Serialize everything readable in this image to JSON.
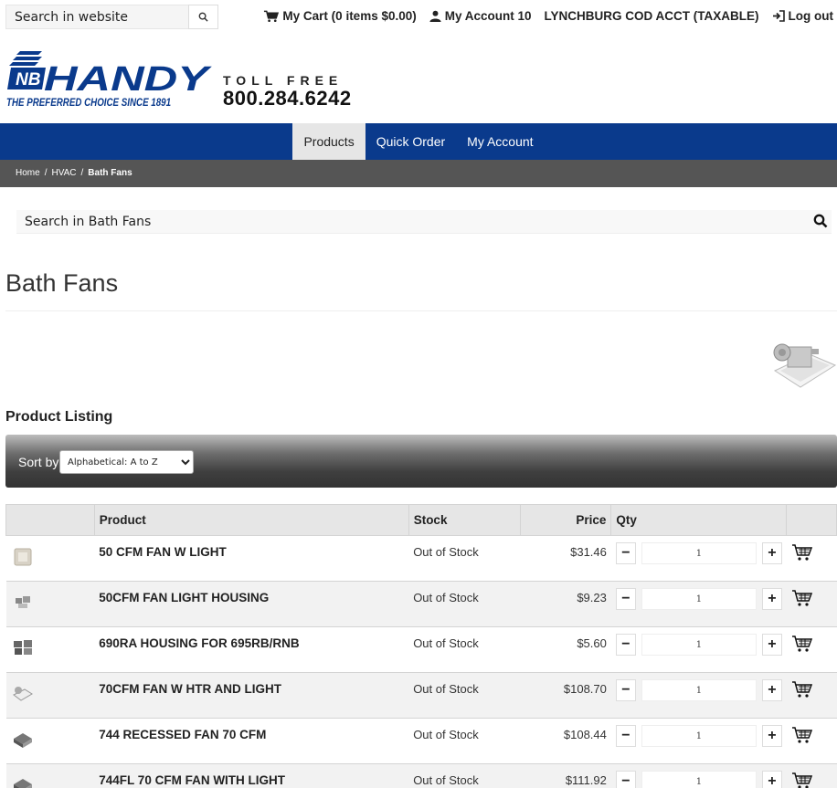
{
  "header": {
    "search_placeholder": "Search in website",
    "cart_label": "My Cart (0 items $0.00)",
    "account_label": "My Account 10",
    "company_label": "LYNCHBURG COD ACCT (TAXABLE)",
    "logout_label": "Log out"
  },
  "brand": {
    "logo_badge": "NB",
    "logo_name": "HANDY",
    "tagline": "THE PREFERRED CHOICE SINCE 1891",
    "tollfree_label": "TOLL FREE",
    "phone": "800.284.6242",
    "primary_color": "#0a3a8c"
  },
  "nav": {
    "items": [
      {
        "label": "Products"
      },
      {
        "label": "Quick Order"
      },
      {
        "label": "My Account"
      }
    ]
  },
  "breadcrumb": {
    "items": [
      {
        "label": "Home"
      },
      {
        "label": "HVAC"
      },
      {
        "label": "Bath Fans"
      }
    ]
  },
  "category": {
    "search_placeholder": "Search in Bath Fans",
    "title": "Bath Fans",
    "listing_title": "Product Listing",
    "sort_label": "Sort by",
    "sort_selected": "Alphabetical: A to Z"
  },
  "table": {
    "headers": {
      "product": "Product",
      "stock": "Stock",
      "price": "Price",
      "qty": "Qty"
    },
    "rows": [
      {
        "name": "50 CFM FAN W LIGHT",
        "stock": "Out of Stock",
        "price": "$31.46",
        "qty": "1"
      },
      {
        "name": "50CFM FAN LIGHT HOUSING",
        "stock": "Out of Stock",
        "price": "$9.23",
        "qty": "1"
      },
      {
        "name": "690RA HOUSING FOR 695RB/RNB",
        "stock": "Out of Stock",
        "price": "$5.60",
        "qty": "1"
      },
      {
        "name": "70CFM FAN W HTR AND LIGHT",
        "stock": "Out of Stock",
        "price": "$108.70",
        "qty": "1"
      },
      {
        "name": "744 RECESSED FAN 70 CFM",
        "stock": "Out of Stock",
        "price": "$108.44",
        "qty": "1"
      },
      {
        "name": "744FL 70 CFM FAN WITH LIGHT",
        "stock": "Out of Stock",
        "price": "$111.92",
        "qty": "1"
      }
    ]
  }
}
